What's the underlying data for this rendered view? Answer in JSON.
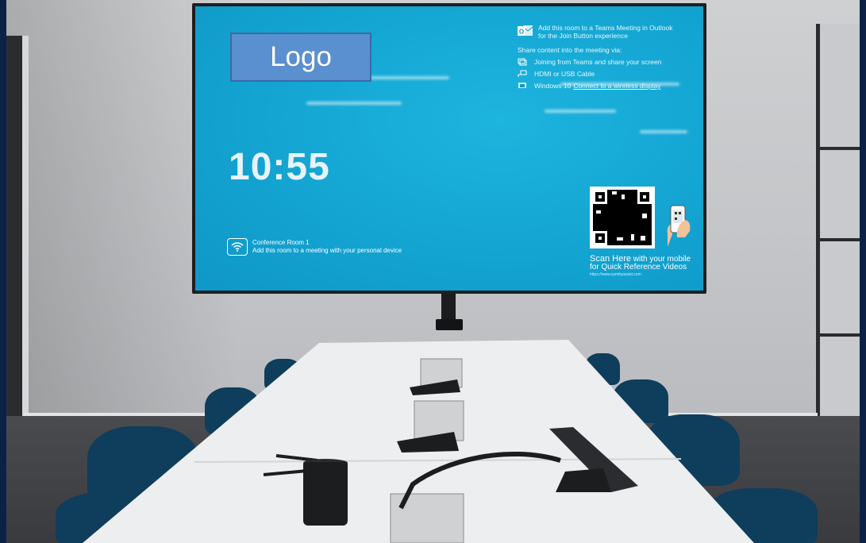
{
  "screen": {
    "logo_text": "Logo",
    "clock": "10:55",
    "room": {
      "name": "Conference Room 1",
      "hint": "Add this room to a meeting with your personal device"
    },
    "outlook": {
      "line1": "Add this room to a Teams Meeting in Outlook",
      "line2": "for the Join Button experience"
    },
    "share_label": "Share content into the meeting via:",
    "share_options": [
      {
        "text": "Joining from Teams and share your screen",
        "icon": "screen-share-icon"
      },
      {
        "text": "HDMI or USB Cable",
        "icon": "cable-icon"
      },
      {
        "prefix": "Windows 10 ",
        "link": "Connect to a wireless display",
        "icon": "wireless-display-icon"
      }
    ],
    "qr": {
      "scan_big": "Scan Here",
      "scan_rest": " with your mobile",
      "scan_line2": "for Quick Reference Videos",
      "url": "https://www.symityassist.com"
    }
  },
  "colors": {
    "screen_bg": "#13a3d1",
    "logo_bg": "#5a8fd0",
    "chair": "#0f3d5c",
    "frame": "#0d2147"
  }
}
